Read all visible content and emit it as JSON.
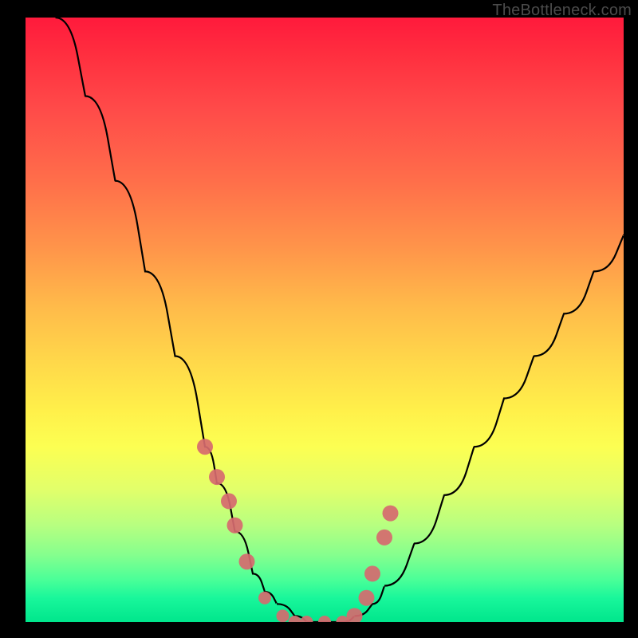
{
  "watermark": {
    "text": "TheBottleneck.com"
  },
  "chart_data": {
    "type": "line",
    "title": "",
    "xlabel": "",
    "ylabel": "",
    "xlim": [
      0,
      100
    ],
    "ylim": [
      0,
      100
    ],
    "series": [
      {
        "name": "bottleneck-curve",
        "x": [
          5,
          10,
          15,
          20,
          25,
          30,
          32,
          35,
          38,
          40,
          42,
          45,
          47,
          50,
          53,
          55,
          58,
          60,
          65,
          70,
          75,
          80,
          85,
          90,
          95,
          100
        ],
        "values": [
          100,
          87,
          73,
          58,
          44,
          29,
          23,
          15,
          8,
          5,
          3,
          1,
          0,
          0,
          0,
          1,
          3,
          6,
          13,
          21,
          29,
          37,
          44,
          51,
          58,
          64
        ]
      }
    ],
    "markers": {
      "name": "highlight-dots",
      "x": [
        30,
        32,
        34,
        35,
        37,
        40,
        43,
        45,
        47,
        50,
        53,
        55,
        57,
        58,
        60,
        61
      ],
      "values": [
        29,
        24,
        20,
        16,
        10,
        4,
        1,
        0,
        0,
        0,
        0,
        1,
        4,
        8,
        14,
        18
      ]
    },
    "gradient_stops": [
      {
        "pos": 0,
        "color": "#ff1a3c"
      },
      {
        "pos": 50,
        "color": "#ffd84a"
      },
      {
        "pos": 75,
        "color": "#e2ff6a"
      },
      {
        "pos": 100,
        "color": "#00e68c"
      }
    ]
  },
  "plot": {
    "inner_w": 750,
    "inner_h": 758
  }
}
